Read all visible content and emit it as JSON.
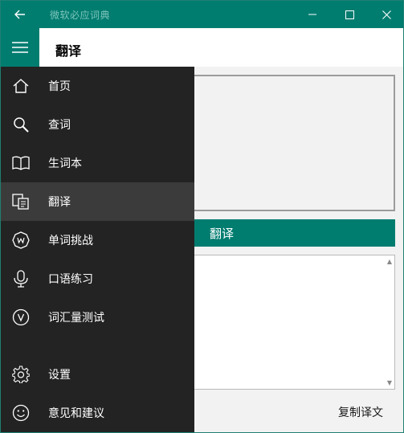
{
  "titlebar": {
    "app_title": "微软必应词典"
  },
  "header": {
    "page_title": "翻译"
  },
  "nav": {
    "items": [
      {
        "label": "首页",
        "icon": "home-icon"
      },
      {
        "label": "查词",
        "icon": "search-icon"
      },
      {
        "label": "生词本",
        "icon": "book-icon"
      },
      {
        "label": "翻译",
        "icon": "translate-icon",
        "selected": true
      },
      {
        "label": "单词挑战",
        "icon": "word-challenge-icon"
      },
      {
        "label": "口语练习",
        "icon": "microphone-icon"
      },
      {
        "label": "词汇量测试",
        "icon": "vocab-test-icon"
      },
      {
        "label": "设置",
        "icon": "gear-icon"
      },
      {
        "label": "意见和建议",
        "icon": "smiley-icon"
      }
    ]
  },
  "main": {
    "translate_button": "翻译",
    "copy_button": "复制译文",
    "source_text": "",
    "result_text": ""
  },
  "colors": {
    "accent": "#017d70",
    "nav_background": "#232323",
    "nav_selected": "#3b3b3b"
  }
}
